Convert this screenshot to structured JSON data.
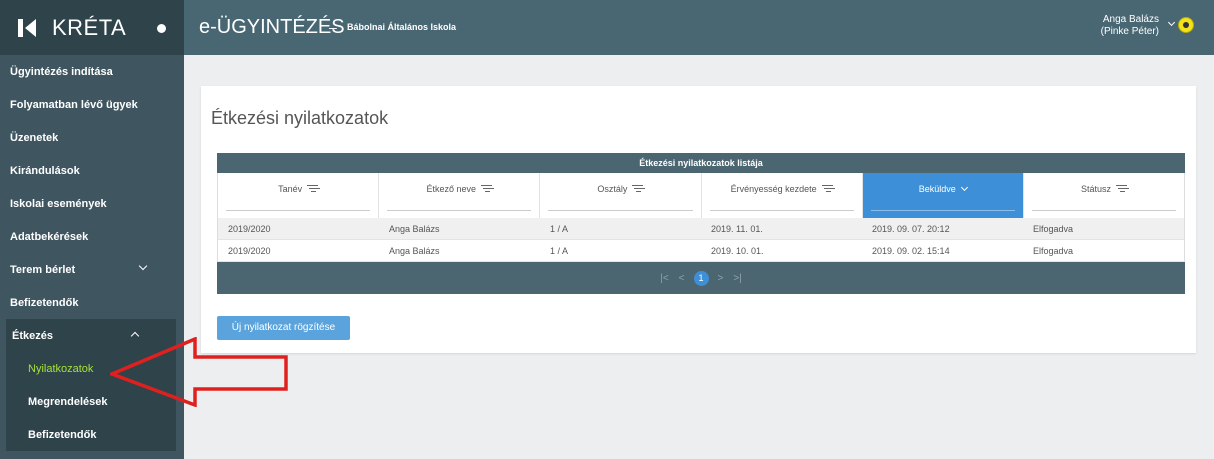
{
  "brand": {
    "name": "KRÉTA"
  },
  "sidebar": {
    "items": [
      {
        "label": "Ügyintézés indítása"
      },
      {
        "label": "Folyamatban lévő ügyek"
      },
      {
        "label": "Üzenetek"
      },
      {
        "label": "Kirándulások"
      },
      {
        "label": "Iskolai események"
      },
      {
        "label": "Adatbekérések"
      },
      {
        "label": "Terem bérlet"
      },
      {
        "label": "Befizetendők"
      }
    ],
    "group": {
      "label": "Étkezés",
      "children": [
        {
          "label": "Nyilatkozatok",
          "active": true
        },
        {
          "label": "Megrendelések"
        },
        {
          "label": "Befizetendők"
        }
      ]
    }
  },
  "header": {
    "title": "e-ÜGYINTÉZÉS",
    "separator": "–",
    "school": "Bábolnai Általános Iskola",
    "user_line1": "Anga Balázs",
    "user_line2": "(Pinke Péter)"
  },
  "main": {
    "title": "Étkezési nyilatkozatok",
    "grid": {
      "caption": "Étkezési nyilatkozatok listája",
      "columns": [
        "Tanév",
        "Étkező neve",
        "Osztály",
        "Érvényesség kezdete",
        "Beküldve",
        "Státusz"
      ],
      "rows": [
        [
          "2019/2020",
          "Anga Balázs",
          "1 / A",
          "2019. 11. 01.",
          "2019. 09. 07. 20:12",
          "Elfogadva"
        ],
        [
          "2019/2020",
          "Anga Balázs",
          "1 / A",
          "2019. 10. 01.",
          "2019. 09. 02. 15:14",
          "Elfogadva"
        ]
      ],
      "pager": {
        "first": "|<",
        "prev": "<",
        "page": "1",
        "next": ">",
        "last": ">|"
      }
    },
    "new_button": "Új nyilatkozat rögzítése"
  },
  "colors": {
    "sidebar_bg": "#3f5660",
    "topbar_bg": "#496773",
    "accent_blue": "#3d8fd8",
    "active_green": "#a6e23a",
    "annotation_red": "#e0201e"
  }
}
